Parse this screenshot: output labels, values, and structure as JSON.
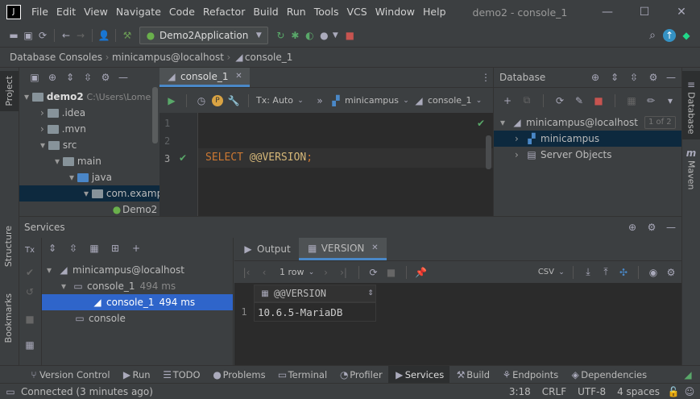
{
  "menu": [
    "File",
    "Edit",
    "View",
    "Navigate",
    "Code",
    "Refactor",
    "Build",
    "Run",
    "Tools",
    "VCS",
    "Window",
    "Help"
  ],
  "window_title": "demo2 - console_1",
  "toolbar": {
    "run_config": "Demo2Application"
  },
  "breadcrumb": [
    "Database Consoles",
    "minicampus@localhost",
    "console_1"
  ],
  "project": {
    "root": "demo2",
    "root_path": "C:\\Users\\Lome",
    "items": [
      ".idea",
      ".mvn",
      "src",
      "main",
      "java",
      "com.examp",
      "Demo2"
    ]
  },
  "editor": {
    "tab": "console_1",
    "tx_label": "Tx: Auto",
    "schema": "minicampus",
    "console": "console_1",
    "line_numbers": [
      "1",
      "2",
      "3"
    ],
    "code_kw": "SELECT",
    "code_fn": "@@VERSION",
    "code_end": ";"
  },
  "database": {
    "title": "Database",
    "datasource": "minicampus@localhost",
    "count": "1 of 2",
    "items": [
      "minicampus",
      "Server Objects"
    ]
  },
  "services": {
    "title": "Services",
    "tree": {
      "datasource": "minicampus@localhost",
      "session": "console_1",
      "session_time": "494 ms",
      "selected": "console_1",
      "selected_time": "494 ms",
      "other": "console"
    },
    "tabs": [
      "Output",
      "VERSION"
    ],
    "rows_label": "1 row",
    "export_label": "CSV",
    "column": "@@VERSION",
    "row_num": "1",
    "value": "10.6.5-MariaDB"
  },
  "left_strip": [
    "Project",
    "Structure",
    "Bookmarks"
  ],
  "right_strip": [
    "Database",
    "Maven"
  ],
  "bottom_tabs": [
    "Version Control",
    "Run",
    "TODO",
    "Problems",
    "Terminal",
    "Profiler",
    "Services",
    "Build",
    "Endpoints",
    "Dependencies"
  ],
  "status": {
    "message": "Connected (3 minutes ago)",
    "position": "3:18",
    "line_sep": "CRLF",
    "encoding": "UTF-8",
    "indent": "4 spaces"
  }
}
